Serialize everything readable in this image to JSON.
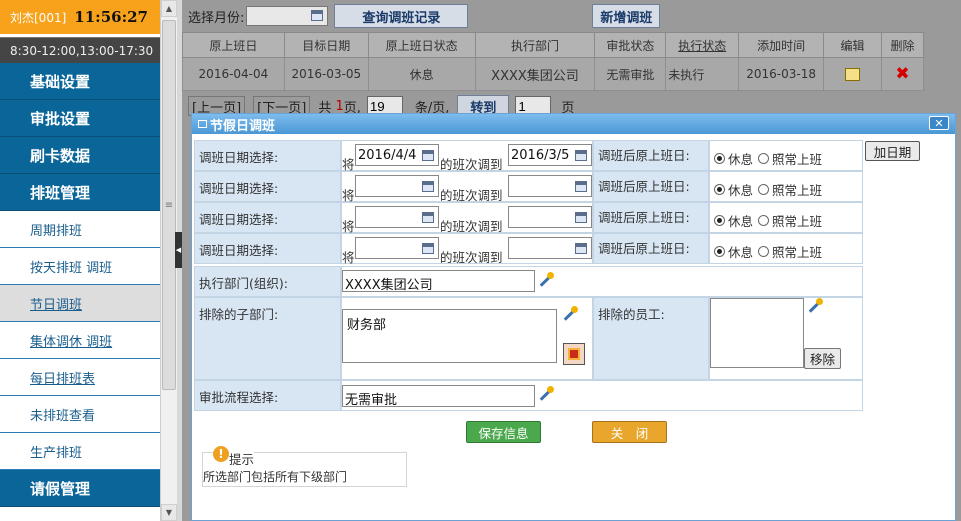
{
  "user": {
    "name": "刘杰[001]",
    "time": "11:56:27",
    "hours": "8:30-12:00,13:00-17:30"
  },
  "nav": [
    {
      "label": "基础设置",
      "type": "main"
    },
    {
      "label": "审批设置",
      "type": "main"
    },
    {
      "label": "刷卡数据",
      "type": "main"
    },
    {
      "label": "排班管理",
      "type": "main"
    },
    {
      "label": "周期排班",
      "type": "sub"
    },
    {
      "label": "按天排班 调班",
      "type": "sub"
    },
    {
      "label": "节日调班",
      "type": "sub",
      "active": true
    },
    {
      "label": "集体调休 调班",
      "type": "sub"
    },
    {
      "label": "每日排班表",
      "type": "sub"
    },
    {
      "label": "未排班查看",
      "type": "sub"
    },
    {
      "label": "生产排班",
      "type": "sub"
    },
    {
      "label": "请假管理",
      "type": "main"
    }
  ],
  "toolbar": {
    "month_label": "选择月份:",
    "query_btn": "查询调班记录",
    "add_btn": "新增调班"
  },
  "grid": {
    "headers": [
      "原上班日",
      "目标日期",
      "原上班日状态",
      "执行部门",
      "审批状态",
      "执行状态",
      "添加时间",
      "编辑",
      "删除"
    ],
    "rows": [
      {
        "orig_date": "2016-04-04",
        "target_date": "2016-03-05",
        "orig_status": "休息",
        "dept": "XXXX集团公司",
        "approval": "无需审批",
        "exec": "未执行",
        "added": "2016-03-18"
      }
    ]
  },
  "pager": {
    "prev": "[上一页]",
    "next": "[下一页]",
    "total_pre": "共",
    "total_pages": "1",
    "total_post": "页,",
    "per_page": "19",
    "per_page_label": "条/页,",
    "go": "转到",
    "page": "1",
    "page_label": "页"
  },
  "dialog": {
    "title": "节假日调班",
    "date_rows": [
      {
        "label": "调班日期选择:",
        "from": "2016/4/4",
        "to": "2016/3/5",
        "jiang": "将",
        "mid": "的班次调到",
        "after_label": "调班后原上班日:",
        "opt1": "休息",
        "opt2": "照常上班",
        "add_btn": "加日期"
      },
      {
        "label": "调班日期选择:",
        "from": "",
        "to": "",
        "jiang": "将",
        "mid": "的班次调到",
        "after_label": "调班后原上班日:",
        "opt1": "休息",
        "opt2": "照常上班"
      },
      {
        "label": "调班日期选择:",
        "from": "",
        "to": "",
        "jiang": "将",
        "mid": "的班次调到",
        "after_label": "调班后原上班日:",
        "opt1": "休息",
        "opt2": "照常上班"
      },
      {
        "label": "调班日期选择:",
        "from": "",
        "to": "",
        "jiang": "将",
        "mid": "的班次调到",
        "after_label": "调班后原上班日:",
        "opt1": "休息",
        "opt2": "照常上班"
      }
    ],
    "exec_dept_label": "执行部门(组织):",
    "exec_dept": "XXXX集团公司",
    "excl_subdept_label": "排除的子部门:",
    "excl_subdept": "财务部",
    "excl_staff_label": "排除的员工:",
    "remove_btn": "移除",
    "flow_label": "审批流程选择:",
    "flow": "无需审批",
    "save_btn": "保存信息",
    "close_btn": "关　闭",
    "tip_title": "提示",
    "tip_text": "所选部门包括所有下级部门"
  }
}
